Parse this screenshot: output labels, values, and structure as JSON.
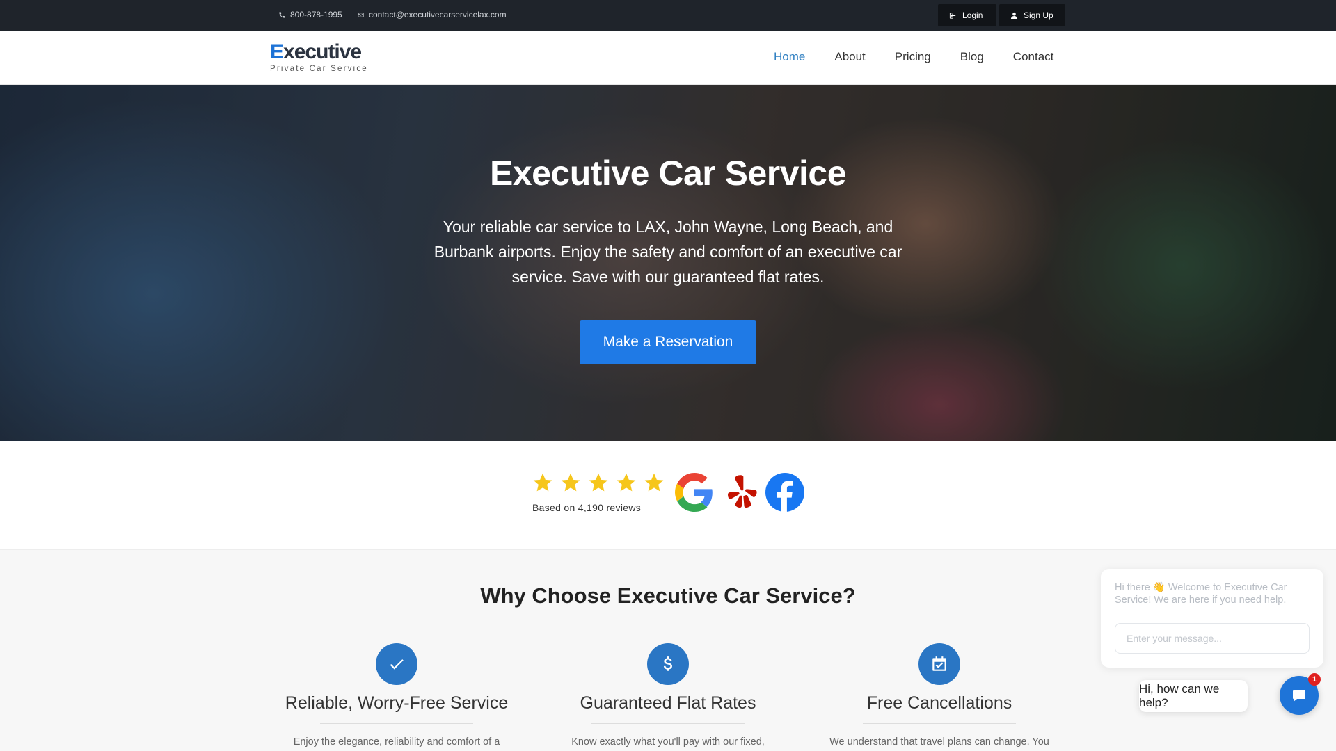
{
  "topbar": {
    "phone": "800-878-1995",
    "email": "contact@executivecarservicelax.com",
    "login_label": "Login",
    "signup_label": "Sign Up"
  },
  "header": {
    "logo_first_letter": "E",
    "logo_rest": "xecutive",
    "logo_subtitle": "Private Car Service",
    "nav": [
      {
        "label": "Home",
        "active": true
      },
      {
        "label": "About"
      },
      {
        "label": "Pricing"
      },
      {
        "label": "Blog"
      },
      {
        "label": "Contact"
      }
    ]
  },
  "hero": {
    "title": "Executive Car Service",
    "description": "Your reliable car service to LAX, John Wayne, Long Beach, and Burbank airports. Enjoy the safety and comfort of an executive car service. Save with our guaranteed flat rates.",
    "cta_label": "Make a Reservation"
  },
  "reviews": {
    "rating": 5,
    "max_rating": 5,
    "count_text": "Based on 4,190 reviews",
    "sources": [
      "google-logo",
      "yelp-logo",
      "facebook-logo"
    ]
  },
  "why": {
    "title_prefix": "Why ",
    "title_bold": "Choose",
    "title_suffix": " Executive Car Service?",
    "features": [
      {
        "icon": "check-icon",
        "title": "Reliable, Worry-Free Service",
        "text": "Enjoy the elegance, reliability and comfort of a"
      },
      {
        "icon": "dollar-icon",
        "title": "Guaranteed Flat Rates",
        "text": "Know exactly what you'll pay with our fixed,"
      },
      {
        "icon": "calendar-check-icon",
        "title": "Free Cancellations",
        "text": "We understand that travel plans can change. You"
      }
    ]
  },
  "chat": {
    "greeting": "Hi there 👋 Welcome to Executive Car Service! We are here if you need help.",
    "input_placeholder": "Enter your message...",
    "bubble_text": "Hi, how can we help?",
    "unread_count": "1"
  },
  "colors": {
    "accent": "#1f7ae6",
    "topbar_bg": "#1f242b",
    "feature_icon_bg": "#2a76c4",
    "star": "#f6c61b"
  }
}
